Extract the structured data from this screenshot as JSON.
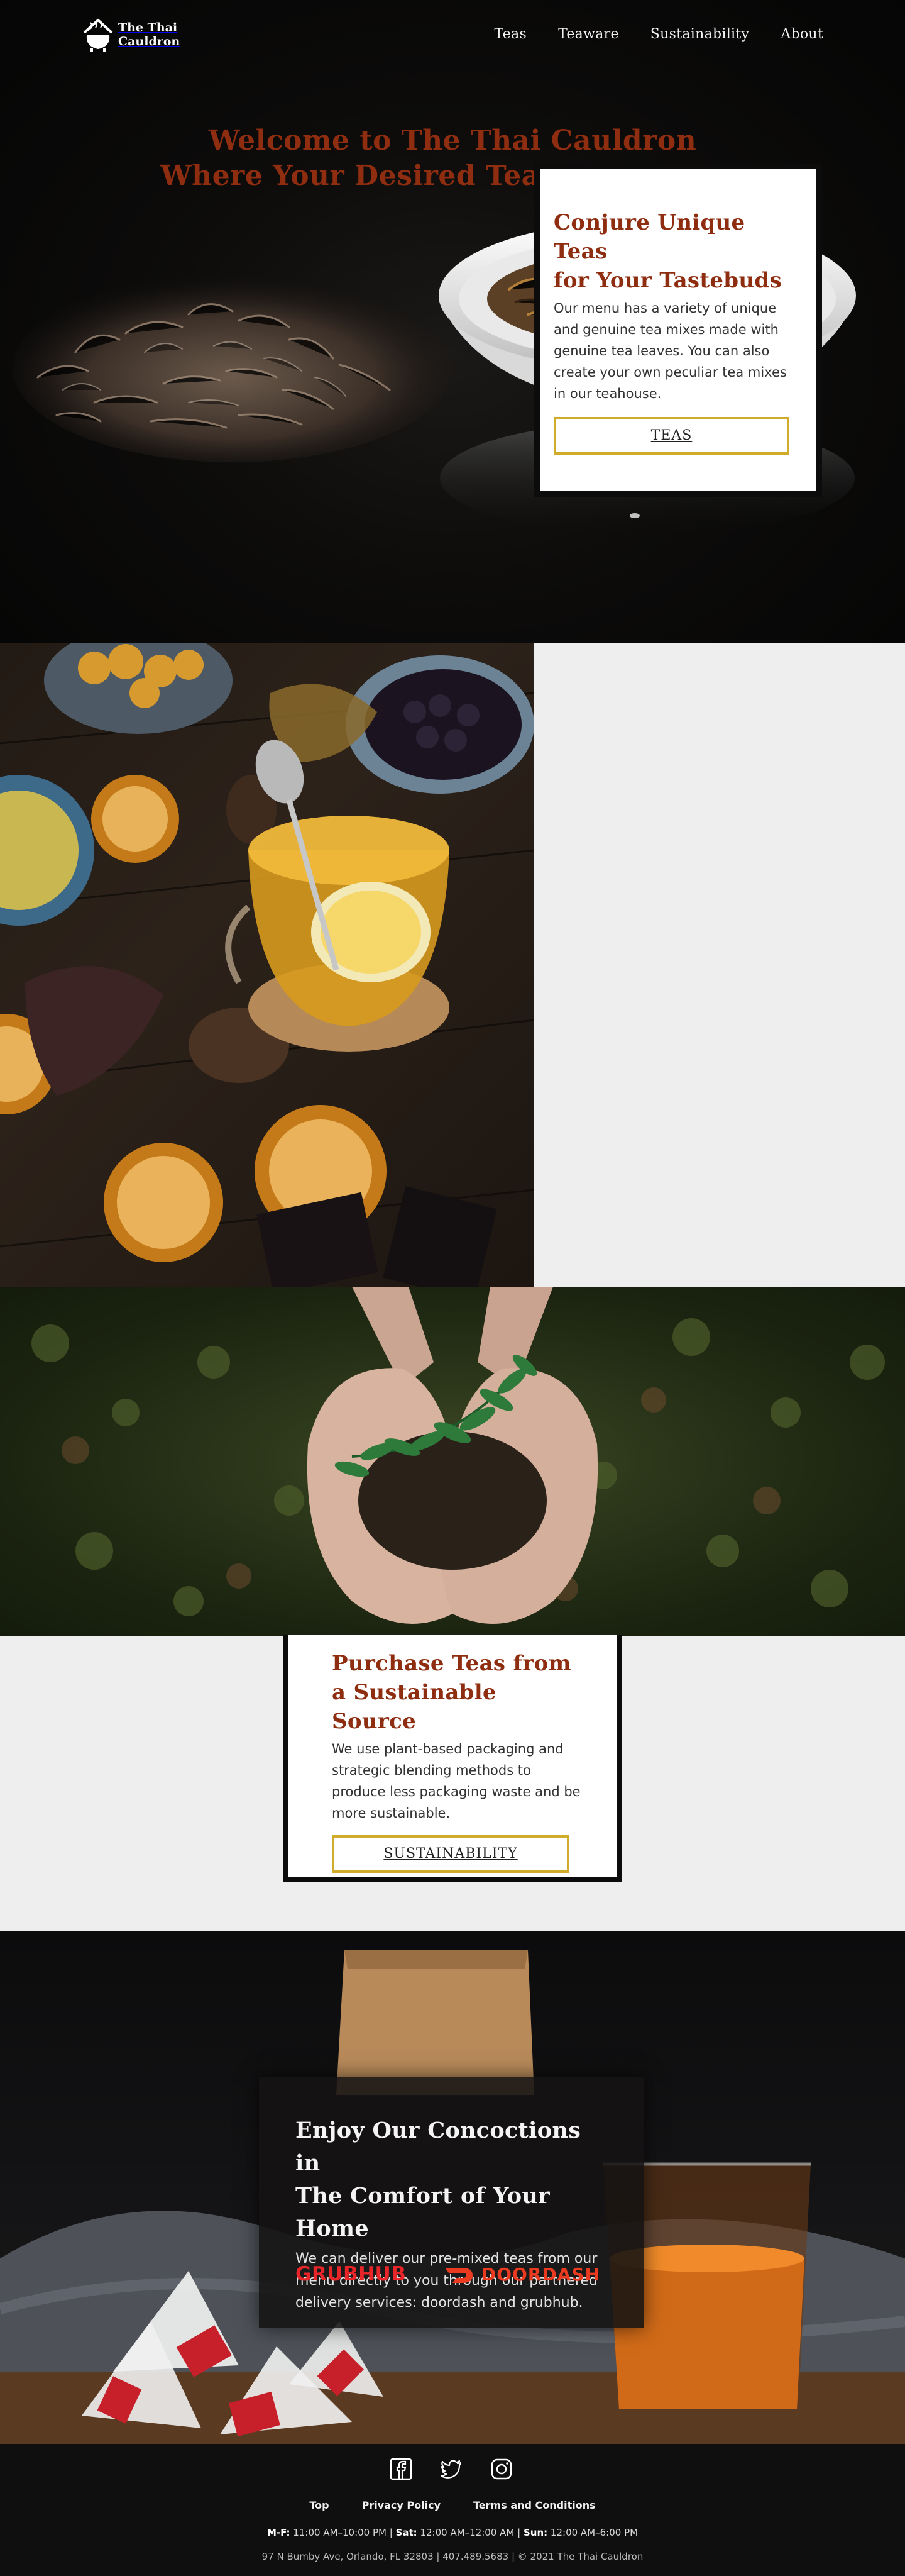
{
  "header": {
    "logo_line1": "The Thai",
    "logo_line2": "Cauldron",
    "nav": [
      {
        "label": "Teas"
      },
      {
        "label": "Teaware"
      },
      {
        "label": "Sustainability"
      },
      {
        "label": "About"
      }
    ]
  },
  "hero": {
    "title_line1": "Welcome to The Thai Cauldron",
    "title_line2": "Where Your Desired Teas are Brewed"
  },
  "conjure": {
    "title_line1": "Conjure Unique Teas",
    "title_line2": "for Your Tastebuds",
    "body": "Our menu has a variety of unique and genuine tea mixes made with genuine tea leaves. You can also create your own peculiar tea mixes in our teahouse.",
    "button": "TEAS"
  },
  "sustainable": {
    "title_line1": "Purchase Teas from",
    "title_line2": "a Sustainable Source",
    "body": "We use plant-based packaging and strategic blending methods to produce less packaging waste and be more sustainable.",
    "button": "SUSTAINABILITY"
  },
  "enjoy": {
    "title_line1": "Enjoy Our Concoctions in",
    "title_line2": "The Comfort of Your Home",
    "body": "We can deliver our pre-mixed teas from our menu directly to you through our partnered delivery services: doordash and grubhub.",
    "grubhub": "GRUBHUB",
    "doordash": "DOORDASH"
  },
  "footer": {
    "social": [
      "facebook-icon",
      "twitter-icon",
      "instagram-icon"
    ],
    "links": [
      {
        "label": "Top"
      },
      {
        "label": "Privacy Policy"
      },
      {
        "label": "Terms and Conditions"
      }
    ],
    "hours": {
      "mf_label": "M-F:",
      "mf_value": "11:00 AM–10:00 PM",
      "sat_label": "Sat:",
      "sat_value": "12:00 AM–12:00 AM",
      "sun_label": "Sun:",
      "sun_value": "12:00 AM–6:00 PM"
    },
    "address": "97 N Bumby Ave, Orlando, FL 32803 | 407.489.5683 | © 2021 The Thai Cauldron"
  },
  "colors": {
    "accent_red": "#8e2d10",
    "button_gold": "#d1ab2a",
    "grubhub_red": "#e8262a",
    "doordash_red": "#ea3a1f"
  }
}
